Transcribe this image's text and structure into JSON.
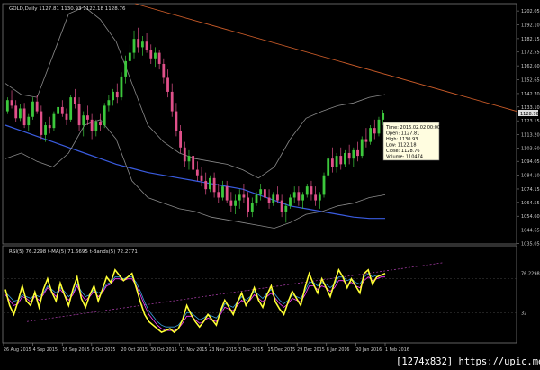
{
  "app": {
    "symbol_header": "GOLD,Daily  1127.81 1130.93 1122.18 1128.76",
    "indicator_header": "RSI(5) 76.2298   t-MA(5) 71.6695   t-Bands(5) 72.2771",
    "watermark": "[1274x832] https://upic.me/"
  },
  "tooltip": {
    "lines": [
      "Time: 2016.02.02 00:00",
      "Open: 1127.81",
      "High: 1130.93",
      "Low: 1122.18",
      "Close: 1128.76",
      "Volume: 110474"
    ]
  },
  "colors": {
    "background": "#000000",
    "bull_candle": "#3cc83c",
    "bear_candle": "#e0508a",
    "ma_blue": "#3a5ce0",
    "bollinger": "#8a8a8a",
    "trendline": "#c85a28",
    "rsi": "#ffff33",
    "rsi_ma": "#ff40ff",
    "rsi_bands": "#3aa0e0"
  },
  "chart_data": [
    {
      "type": "candlestick",
      "title": "GOLD,Daily",
      "ylim": [
        1036,
        1206
      ],
      "y_ticks": [
        "1202.05",
        "1192.10",
        "1182.15",
        "1172.55",
        "1162.60",
        "1152.65",
        "1142.70",
        "1133.10",
        "1123.15",
        "1113.20",
        "1103.60",
        "1094.05",
        "1084.10",
        "1074.15",
        "1064.55",
        "1054.60",
        "1044.65",
        "1035.05"
      ],
      "x_tick_labels": [
        "26 Aug 2015",
        "4 Sep 2015",
        "16 Sep 2015",
        "8 Oct 2015",
        "20 Oct 2015",
        "30 Oct 2015",
        "11 Nov 2015",
        "23 Nov 2015",
        "3 Dec 2015",
        "15 Dec 2015",
        "29 Dec 2015",
        "8 Jan 2016",
        "20 Jan 2016",
        "1 Feb 2016"
      ],
      "price_marker": "1128.76",
      "ohlc": [
        [
          1130,
          1140,
          1128,
          1138
        ],
        [
          1138,
          1145,
          1132,
          1134
        ],
        [
          1134,
          1138,
          1122,
          1125
        ],
        [
          1125,
          1135,
          1123,
          1132
        ],
        [
          1132,
          1136,
          1118,
          1120
        ],
        [
          1120,
          1128,
          1116,
          1126
        ],
        [
          1126,
          1140,
          1124,
          1137
        ],
        [
          1137,
          1142,
          1128,
          1130
        ],
        [
          1130,
          1134,
          1110,
          1113
        ],
        [
          1113,
          1122,
          1108,
          1120
        ],
        [
          1120,
          1126,
          1114,
          1118
        ],
        [
          1118,
          1130,
          1116,
          1128
        ],
        [
          1128,
          1136,
          1124,
          1133
        ],
        [
          1133,
          1138,
          1126,
          1128
        ],
        [
          1128,
          1132,
          1120,
          1124
        ],
        [
          1124,
          1142,
          1122,
          1140
        ],
        [
          1140,
          1146,
          1132,
          1135
        ],
        [
          1135,
          1140,
          1116,
          1120
        ],
        [
          1120,
          1130,
          1112,
          1127
        ],
        [
          1127,
          1134,
          1120,
          1124
        ],
        [
          1124,
          1128,
          1110,
          1116
        ],
        [
          1116,
          1124,
          1112,
          1122
        ],
        [
          1122,
          1128,
          1116,
          1120
        ],
        [
          1120,
          1136,
          1118,
          1134
        ],
        [
          1134,
          1142,
          1130,
          1138
        ],
        [
          1138,
          1146,
          1134,
          1144
        ],
        [
          1144,
          1150,
          1136,
          1140
        ],
        [
          1140,
          1158,
          1138,
          1155
        ],
        [
          1155,
          1170,
          1150,
          1166
        ],
        [
          1166,
          1178,
          1160,
          1172
        ],
        [
          1172,
          1188,
          1168,
          1182
        ],
        [
          1182,
          1190,
          1172,
          1176
        ],
        [
          1176,
          1184,
          1170,
          1180
        ],
        [
          1180,
          1186,
          1172,
          1174
        ],
        [
          1174,
          1178,
          1164,
          1168
        ],
        [
          1168,
          1176,
          1162,
          1172
        ],
        [
          1172,
          1174,
          1160,
          1164
        ],
        [
          1164,
          1168,
          1150,
          1154
        ],
        [
          1154,
          1160,
          1140,
          1144
        ],
        [
          1144,
          1150,
          1126,
          1130
        ],
        [
          1130,
          1136,
          1112,
          1116
        ],
        [
          1116,
          1120,
          1100,
          1104
        ],
        [
          1104,
          1108,
          1090,
          1094
        ],
        [
          1094,
          1102,
          1088,
          1098
        ],
        [
          1098,
          1102,
          1084,
          1088
        ],
        [
          1088,
          1094,
          1080,
          1084
        ],
        [
          1084,
          1090,
          1076,
          1080
        ],
        [
          1080,
          1086,
          1070,
          1074
        ],
        [
          1074,
          1084,
          1072,
          1082
        ],
        [
          1082,
          1086,
          1068,
          1072
        ],
        [
          1072,
          1078,
          1064,
          1068
        ],
        [
          1068,
          1080,
          1066,
          1076
        ],
        [
          1076,
          1080,
          1064,
          1066
        ],
        [
          1066,
          1072,
          1058,
          1062
        ],
        [
          1062,
          1070,
          1056,
          1066
        ],
        [
          1066,
          1074,
          1060,
          1070
        ],
        [
          1070,
          1078,
          1064,
          1068
        ],
        [
          1068,
          1072,
          1054,
          1058
        ],
        [
          1058,
          1068,
          1054,
          1064
        ],
        [
          1064,
          1072,
          1062,
          1070
        ],
        [
          1070,
          1078,
          1066,
          1074
        ],
        [
          1074,
          1080,
          1066,
          1068
        ],
        [
          1068,
          1074,
          1060,
          1064
        ],
        [
          1064,
          1072,
          1062,
          1070
        ],
        [
          1070,
          1076,
          1064,
          1066
        ],
        [
          1066,
          1070,
          1054,
          1058
        ],
        [
          1058,
          1064,
          1050,
          1062
        ],
        [
          1062,
          1070,
          1060,
          1068
        ],
        [
          1068,
          1076,
          1064,
          1072
        ],
        [
          1072,
          1076,
          1062,
          1066
        ],
        [
          1066,
          1072,
          1060,
          1070
        ],
        [
          1070,
          1078,
          1068,
          1076
        ],
        [
          1076,
          1080,
          1066,
          1070
        ],
        [
          1070,
          1076,
          1062,
          1066
        ],
        [
          1066,
          1072,
          1060,
          1070
        ],
        [
          1070,
          1086,
          1068,
          1084
        ],
        [
          1084,
          1098,
          1082,
          1096
        ],
        [
          1096,
          1104,
          1086,
          1090
        ],
        [
          1090,
          1100,
          1086,
          1098
        ],
        [
          1098,
          1104,
          1088,
          1092
        ],
        [
          1092,
          1102,
          1090,
          1100
        ],
        [
          1100,
          1106,
          1092,
          1096
        ],
        [
          1096,
          1104,
          1090,
          1102
        ],
        [
          1102,
          1108,
          1094,
          1098
        ],
        [
          1098,
          1112,
          1096,
          1110
        ],
        [
          1110,
          1118,
          1104,
          1108
        ],
        [
          1108,
          1120,
          1106,
          1118
        ],
        [
          1118,
          1124,
          1110,
          1114
        ],
        [
          1114,
          1126,
          1112,
          1124
        ],
        [
          1124,
          1131,
          1120,
          1128.76
        ]
      ],
      "series": [
        {
          "name": "MA blue",
          "values": [
            1120,
            1116,
            1112,
            1108,
            1104,
            1100,
            1096,
            1092,
            1089,
            1086,
            1084,
            1082,
            1080,
            1078,
            1076,
            1074,
            1070,
            1066,
            1062,
            1060,
            1058,
            1056,
            1054,
            1053,
            1053
          ]
        },
        {
          "name": "Bollinger upper",
          "values": [
            1150,
            1142,
            1140,
            1170,
            1200,
            1205,
            1196,
            1180,
            1150,
            1120,
            1108,
            1100,
            1096,
            1094,
            1092,
            1088,
            1082,
            1090,
            1110,
            1125,
            1130,
            1134,
            1136,
            1140,
            1142
          ]
        },
        {
          "name": "Bollinger lower",
          "values": [
            1096,
            1100,
            1094,
            1090,
            1100,
            1120,
            1124,
            1110,
            1080,
            1068,
            1064,
            1060,
            1058,
            1054,
            1052,
            1050,
            1048,
            1046,
            1050,
            1056,
            1058,
            1062,
            1064,
            1068,
            1070
          ]
        }
      ],
      "trendline": {
        "from": [
          0,
          1230
        ],
        "to": [
          1,
          1130
        ]
      }
    },
    {
      "type": "line",
      "title": "RSI(5)",
      "ylim": [
        0,
        100
      ],
      "y_ticks": [
        "76.2298",
        "32"
      ],
      "series": [
        {
          "name": "RSI(5)",
          "values": [
            58,
            40,
            30,
            45,
            62,
            45,
            40,
            55,
            38,
            58,
            70,
            55,
            45,
            65,
            52,
            40,
            58,
            72,
            48,
            38,
            52,
            62,
            45,
            58,
            72,
            66,
            80,
            74,
            68,
            72,
            76,
            60,
            44,
            30,
            22,
            18,
            14,
            10,
            12,
            14,
            10,
            14,
            24,
            40,
            30,
            22,
            16,
            22,
            30,
            24,
            18,
            34,
            46,
            38,
            30,
            44,
            54,
            40,
            48,
            60,
            46,
            38,
            52,
            62,
            44,
            36,
            30,
            44,
            56,
            48,
            40,
            60,
            76,
            64,
            54,
            70,
            60,
            50,
            66,
            80,
            72,
            60,
            70,
            62,
            54,
            76,
            80,
            64,
            72,
            74,
            76
          ]
        },
        {
          "name": "t-MA(5)",
          "values": [
            52,
            46,
            40,
            42,
            50,
            48,
            44,
            50,
            46,
            52,
            60,
            56,
            50,
            58,
            52,
            46,
            52,
            62,
            52,
            46,
            50,
            56,
            50,
            54,
            62,
            64,
            70,
            70,
            68,
            70,
            70,
            62,
            52,
            40,
            30,
            24,
            18,
            14,
            12,
            12,
            12,
            14,
            20,
            28,
            28,
            24,
            20,
            22,
            26,
            24,
            22,
            30,
            38,
            36,
            34,
            40,
            46,
            42,
            46,
            52,
            48,
            44,
            50,
            54,
            48,
            42,
            38,
            42,
            48,
            46,
            44,
            52,
            62,
            62,
            58,
            62,
            60,
            56,
            60,
            68,
            68,
            64,
            66,
            62,
            60,
            68,
            72,
            68,
            70,
            72,
            72
          ]
        },
        {
          "name": "t-Bands(5)",
          "values": [
            55,
            50,
            45,
            46,
            52,
            50,
            48,
            52,
            50,
            54,
            62,
            58,
            54,
            60,
            56,
            50,
            54,
            64,
            56,
            50,
            52,
            58,
            54,
            56,
            64,
            66,
            72,
            72,
            70,
            72,
            72,
            66,
            56,
            44,
            34,
            28,
            22,
            18,
            16,
            16,
            16,
            18,
            24,
            32,
            32,
            28,
            24,
            26,
            30,
            28,
            26,
            32,
            42,
            40,
            38,
            44,
            50,
            46,
            50,
            56,
            52,
            48,
            54,
            58,
            52,
            46,
            42,
            46,
            52,
            50,
            48,
            56,
            66,
            66,
            62,
            66,
            64,
            60,
            64,
            72,
            72,
            68,
            70,
            66,
            64,
            72,
            76,
            72,
            74,
            74,
            74
          ]
        }
      ]
    }
  ]
}
